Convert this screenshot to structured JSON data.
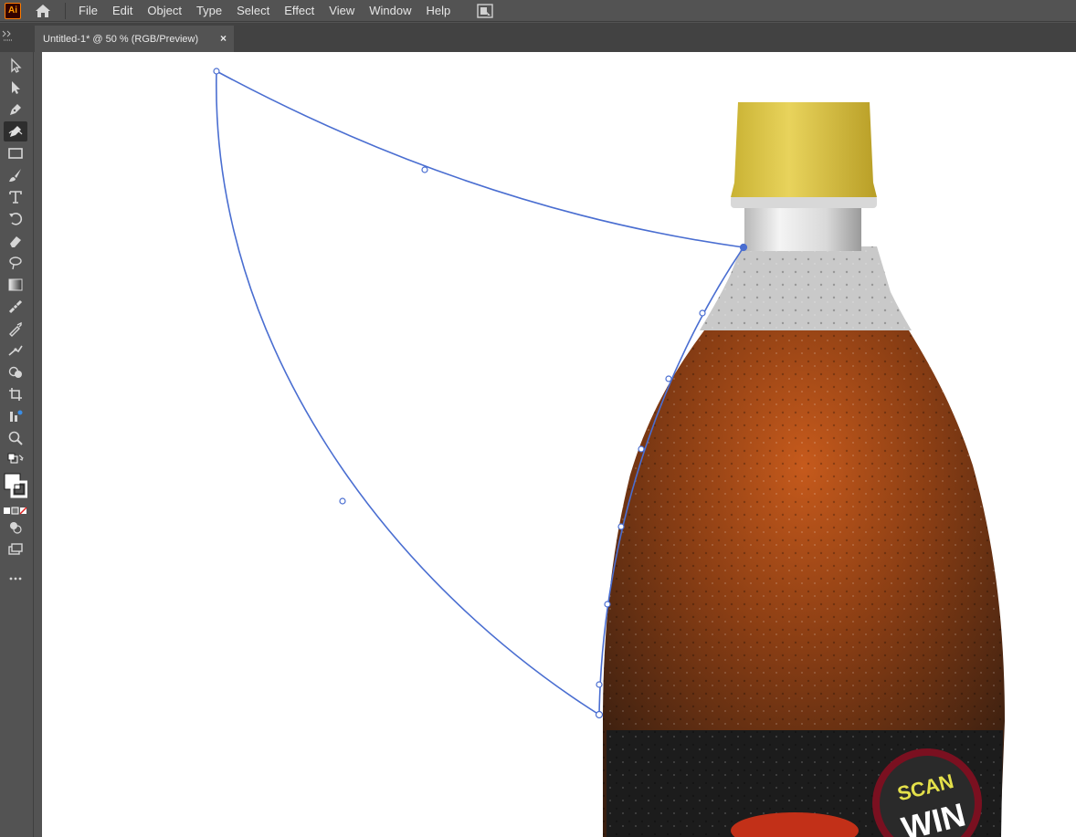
{
  "app": {
    "logo_text": "Ai"
  },
  "menu": {
    "items": [
      "File",
      "Edit",
      "Object",
      "Type",
      "Select",
      "Effect",
      "View",
      "Window",
      "Help"
    ]
  },
  "document": {
    "tab_title": "Untitled-1* @ 50 % (RGB/Preview)",
    "close_glyph": "×"
  },
  "tools": [
    {
      "name": "selection-tool-icon",
      "active": false
    },
    {
      "name": "direct-selection-tool-icon",
      "active": false
    },
    {
      "name": "pen-tool-icon",
      "active": false
    },
    {
      "name": "curvature-tool-icon",
      "active": true
    },
    {
      "name": "rectangle-tool-icon",
      "active": false
    },
    {
      "name": "paintbrush-tool-icon",
      "active": false
    },
    {
      "name": "type-tool-icon",
      "active": false
    },
    {
      "name": "rotate-tool-icon",
      "active": false
    },
    {
      "name": "eraser-tool-icon",
      "active": false
    },
    {
      "name": "lasso-tool-icon",
      "active": false
    },
    {
      "name": "gradient-tool-icon",
      "active": false
    },
    {
      "name": "measure-tool-icon",
      "active": false
    },
    {
      "name": "eyedropper-tool-icon",
      "active": false
    },
    {
      "name": "puppet-warp-tool-icon",
      "active": false
    },
    {
      "name": "shape-builder-tool-icon",
      "active": false
    },
    {
      "name": "artboard-tool-icon",
      "active": false
    },
    {
      "name": "graph-tool-icon",
      "active": false
    },
    {
      "name": "zoom-tool-icon",
      "active": false
    }
  ],
  "label_text": {
    "brand_line1": "SCAN",
    "brand_line2": "WIN"
  },
  "colors": {
    "selection_blue": "#4a6ed1",
    "cap_yellow": "#dcc94a",
    "liquid_brown": "#5c2c14"
  }
}
